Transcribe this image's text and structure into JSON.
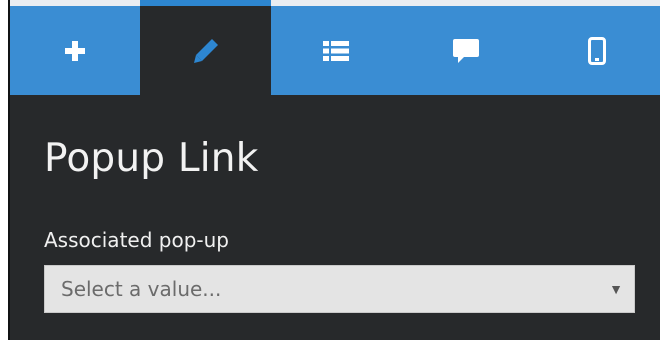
{
  "tabs": [
    {
      "name": "add",
      "icon": "plus-icon",
      "active": false
    },
    {
      "name": "edit",
      "icon": "pencil-icon",
      "active": true
    },
    {
      "name": "list",
      "icon": "list-icon",
      "active": false
    },
    {
      "name": "comment",
      "icon": "speech-bubble-icon",
      "active": false
    },
    {
      "name": "mobile",
      "icon": "mobile-phone-icon",
      "active": false
    }
  ],
  "panel": {
    "title": "Popup Link",
    "field": {
      "label": "Associated pop-up",
      "placeholder": "Select a value...",
      "arrow": "▼"
    }
  },
  "colors": {
    "tab_bar": "#3a8dd3",
    "panel_bg": "#27292b",
    "active_tab_bg": "#27292b",
    "icon": "#ffffff",
    "active_icon": "#2d86d1"
  }
}
